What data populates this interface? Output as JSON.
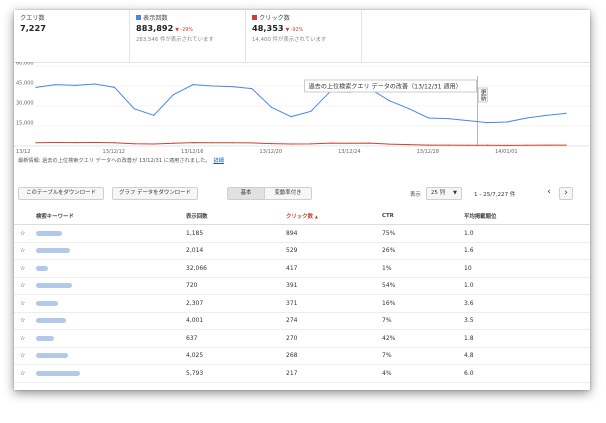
{
  "metrics": [
    {
      "label": "クエリ数",
      "value": "7,227",
      "change": "",
      "subtext": "",
      "color": ""
    },
    {
      "label": "表示回数",
      "value": "883,892",
      "change": "▼ -29%",
      "subtext": "283,546 件が表示されています",
      "color": "#4a86e8"
    },
    {
      "label": "クリック数",
      "value": "48,353",
      "change": "▼ -92%",
      "subtext": "14,400 件が表示されています",
      "color": "#d23f31"
    }
  ],
  "chart_data": {
    "type": "line",
    "y_ticks": [
      "60,000",
      "45,000",
      "30,000",
      "15,000"
    ],
    "ylim": [
      0,
      60000
    ],
    "x_ticks": [
      "13/12",
      "13/12/12",
      "13/12/16",
      "13/12/20",
      "13/12/24",
      "13/12/28",
      "14/01/01"
    ],
    "annotation": "過去の上位検索クエリ データの改善（13/12/31 適用）",
    "annotation_marker": "更新",
    "annotation_x_index": 22.5,
    "series": [
      {
        "name": "表示回数",
        "color": "#4a86e8",
        "values": [
          44000,
          46000,
          45500,
          46500,
          44000,
          28000,
          23000,
          38500,
          46000,
          45000,
          44500,
          43000,
          29000,
          22000,
          26000,
          41000,
          40500,
          43000,
          34000,
          28000,
          21000,
          20500,
          19000,
          17500,
          18000,
          21000,
          23000,
          24500
        ]
      },
      {
        "name": "クリック数",
        "color": "#d23f31",
        "values": [
          2400,
          2600,
          2500,
          2600,
          2400,
          1700,
          1500,
          2100,
          2500,
          2400,
          2400,
          2300,
          1800,
          1500,
          1600,
          2200,
          2100,
          2200,
          1400,
          1000,
          700,
          650,
          600,
          550,
          500,
          600,
          650,
          700
        ]
      }
    ]
  },
  "info": {
    "text": "最新情報: 過去の上位検索クエリ データへの改善が 13/12/31 に適用されました。",
    "link": "詳細"
  },
  "toolbar": {
    "download_table": "このテーブルをダウンロード",
    "download_chart": "グラフ データをダウンロード",
    "seg_basic": "基本",
    "seg_changes": "変動率付き",
    "show_label": "表示",
    "rows_select": "25 列",
    "page_range": "1 - 25/7,227 件",
    "prev": "‹",
    "next": "›"
  },
  "table": {
    "headers": [
      "検索キーワード",
      "表示回数",
      "クリック数",
      "CTR",
      "平均掲載順位"
    ],
    "sorted_arrow": "▲",
    "rows": [
      {
        "impr": "1,185",
        "clicks": "894",
        "ctr": "75%",
        "pos": "1.0"
      },
      {
        "impr": "2,014",
        "clicks": "529",
        "ctr": "26%",
        "pos": "1.6"
      },
      {
        "impr": "32,066",
        "clicks": "417",
        "ctr": "1%",
        "pos": "10"
      },
      {
        "impr": "720",
        "clicks": "391",
        "ctr": "54%",
        "pos": "1.0"
      },
      {
        "impr": "2,307",
        "clicks": "371",
        "ctr": "16%",
        "pos": "3.6"
      },
      {
        "impr": "4,001",
        "clicks": "274",
        "ctr": "7%",
        "pos": "3.5"
      },
      {
        "impr": "637",
        "clicks": "270",
        "ctr": "42%",
        "pos": "1.8"
      },
      {
        "impr": "4,025",
        "clicks": "268",
        "ctr": "7%",
        "pos": "4.8"
      },
      {
        "impr": "5,793",
        "clicks": "217",
        "ctr": "4%",
        "pos": "6.0"
      }
    ]
  }
}
